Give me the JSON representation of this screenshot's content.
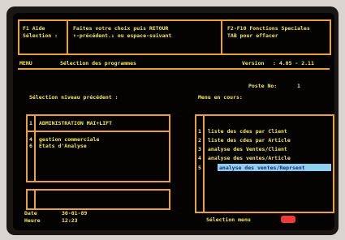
{
  "header": {
    "help_line1": "F1 Aide",
    "help_line2": "Sélection :",
    "instruction_line1": "Faites votre choix puis RETOUR",
    "instruction_line2": "↑-précédent.↓ ou espace-suivant",
    "fkeys_line1": "F2-F10 Fonctions Speciales",
    "fkeys_line2": "TAB pour effacer"
  },
  "title_bar": {
    "label": "MENU",
    "title": "Sélection des programmes",
    "version_label": "Version",
    "version_value": ": 4.05 - 2.11"
  },
  "poste": {
    "label": "Poste No:",
    "value": "1"
  },
  "left_panel": {
    "heading": "Sélection niveau précédent :",
    "items": [
      {
        "num": "1",
        "label": "ADMINISTRATION MAI+LIFT"
      },
      {
        "num": "4",
        "label": "gestion commerciale"
      },
      {
        "num": "6",
        "label": "Etats d'Analyse"
      }
    ]
  },
  "right_panel": {
    "heading": "Menu en cours:",
    "items": [
      {
        "num": "1",
        "label": "liste des cdes par Client"
      },
      {
        "num": "2",
        "label": "liste des cdes par Article"
      },
      {
        "num": "3",
        "label": "analyse des Ventes/Client"
      },
      {
        "num": "4",
        "label": "analyse des ventes/Article"
      },
      {
        "num": "5",
        "label": "analyse des ventes/Reprsent"
      }
    ],
    "selected_index": 4
  },
  "footer": {
    "date_label": "Date",
    "date_value": "30-01-89",
    "time_label": "Heure",
    "time_value": "12:23",
    "selection_label": "Sélection menu"
  },
  "colors": {
    "border": "#e9a23a",
    "text": "#f4e65c",
    "highlight": "#8fd0f0"
  },
  "icons": {
    "enter_key": "enter-key-icon"
  }
}
